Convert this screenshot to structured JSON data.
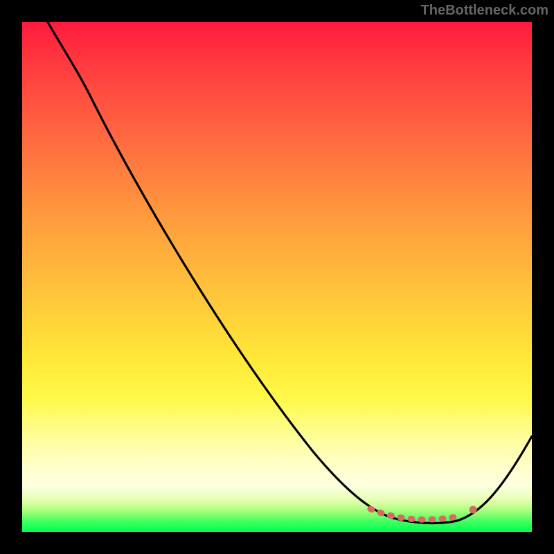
{
  "watermark": "TheBottleneck.com",
  "chart_data": {
    "type": "line",
    "title": "",
    "xlabel": "",
    "ylabel": "",
    "xlim": [
      0,
      100
    ],
    "ylim": [
      0,
      100
    ],
    "series": [
      {
        "name": "bottleneck-curve",
        "x": [
          5,
          10,
          15,
          20,
          25,
          30,
          35,
          40,
          45,
          50,
          55,
          60,
          65,
          70,
          72,
          75,
          78,
          82,
          85,
          88,
          92,
          96,
          100
        ],
        "y": [
          100,
          95,
          89,
          82,
          74,
          66,
          58,
          50,
          42,
          34,
          26,
          19,
          12,
          6,
          3,
          1.5,
          0.8,
          0.5,
          0.5,
          1,
          4,
          10,
          19
        ]
      },
      {
        "name": "optimal-range-marker",
        "x": [
          70,
          72,
          75,
          78,
          82,
          85,
          88
        ],
        "y": [
          4.5,
          2.8,
          1.8,
          1.2,
          1,
          1.2,
          2.2
        ]
      }
    ],
    "gradient_stops": [
      {
        "pct": 0,
        "color": "#ff1a3d"
      },
      {
        "pct": 50,
        "color": "#ffd23a"
      },
      {
        "pct": 90,
        "color": "#ffffd0"
      },
      {
        "pct": 100,
        "color": "#00ff50"
      }
    ]
  }
}
